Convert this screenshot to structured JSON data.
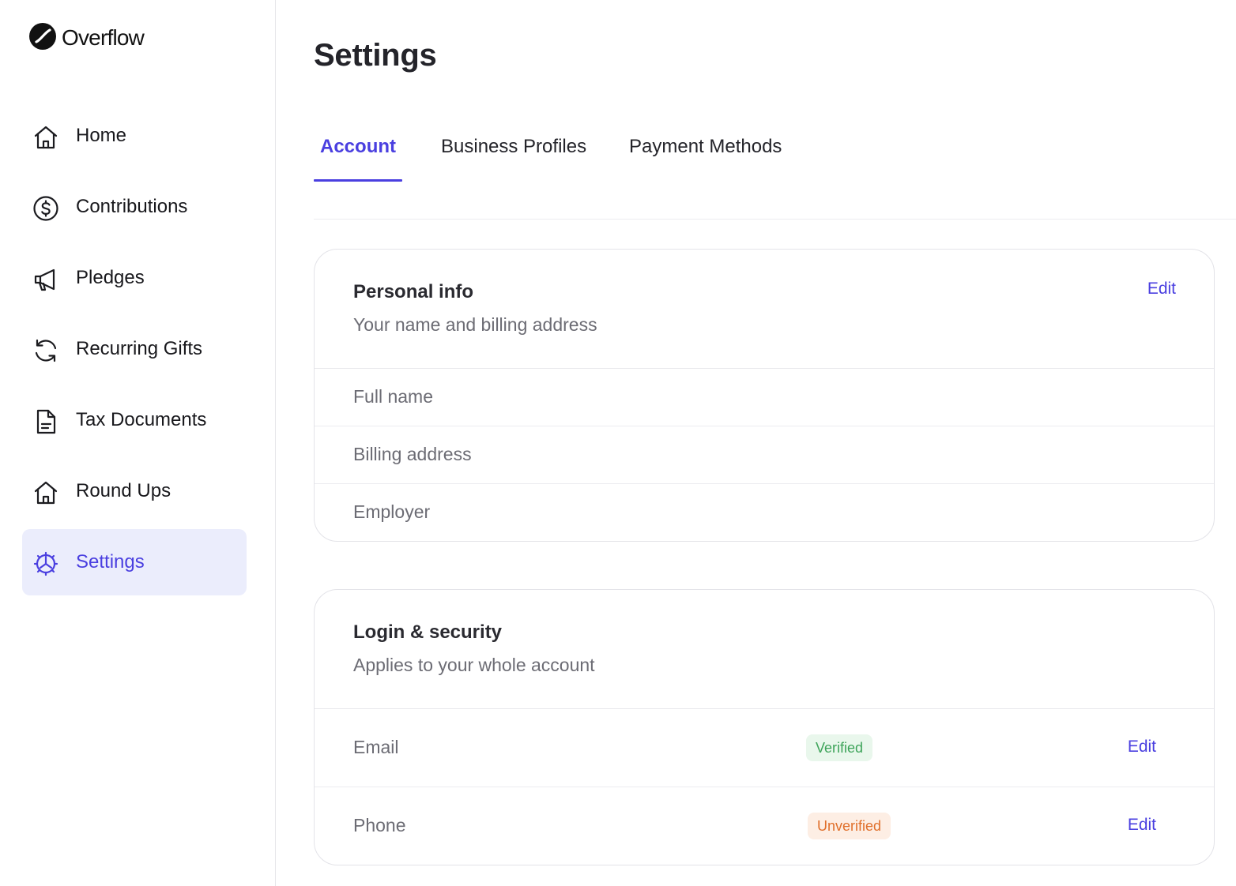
{
  "brand": {
    "name": "Overflow",
    "accent": "#4a3fe0"
  },
  "sidebar": {
    "items": [
      {
        "label": "Home",
        "icon": "home-icon"
      },
      {
        "label": "Contributions",
        "icon": "dollar-circle-icon"
      },
      {
        "label": "Pledges",
        "icon": "megaphone-icon"
      },
      {
        "label": "Recurring Gifts",
        "icon": "refresh-icon"
      },
      {
        "label": "Tax Documents",
        "icon": "document-icon"
      },
      {
        "label": "Round Ups",
        "icon": "home-icon"
      },
      {
        "label": "Settings",
        "icon": "gear-icon",
        "active": true
      }
    ]
  },
  "page": {
    "title": "Settings"
  },
  "tabs": [
    {
      "label": "Account",
      "active": true
    },
    {
      "label": "Business Profiles"
    },
    {
      "label": "Payment Methods"
    }
  ],
  "personal_info": {
    "title": "Personal info",
    "subtitle": "Your name and billing address",
    "edit_label": "Edit",
    "rows": [
      {
        "label": "Full name"
      },
      {
        "label": "Billing address"
      },
      {
        "label": "Employer"
      }
    ]
  },
  "login_security": {
    "title": "Login & security",
    "subtitle": "Applies to your whole account",
    "rows": [
      {
        "label": "Email",
        "status": "Verified",
        "edit_label": "Edit"
      },
      {
        "label": "Phone",
        "status": "Unverified",
        "edit_label": "Edit"
      }
    ]
  }
}
